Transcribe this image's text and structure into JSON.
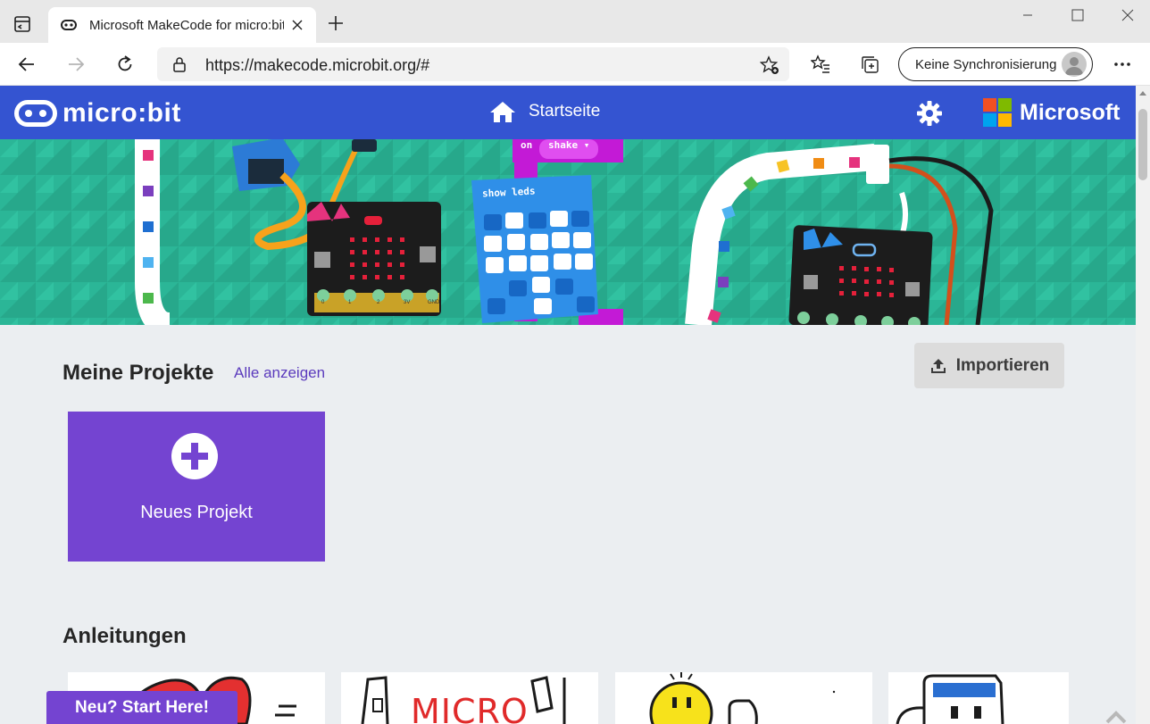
{
  "browser": {
    "tab_title": "Microsoft MakeCode for micro:bit",
    "url": "https://makecode.microbit.org/#",
    "sync_label": "Keine Synchronisierung"
  },
  "header": {
    "logo_text": "micro:bit",
    "home_label": "Startseite",
    "brand_text": "Microsoft",
    "brand_colors": [
      "#f25022",
      "#7fba00",
      "#00a4ef",
      "#ffb900"
    ],
    "accent": "#3454d1"
  },
  "hero": {
    "block_on": "on",
    "block_shake": "shake ▾",
    "block_show_leds": "show leds",
    "pin_labels": [
      "0",
      "1",
      "2",
      "3V",
      "GND"
    ]
  },
  "projects": {
    "title": "Meine Projekte",
    "see_all": "Alle anzeigen",
    "import_label": "Importieren",
    "new_project_label": "Neues Projekt"
  },
  "tutorials": {
    "title": "Anleitungen",
    "card_text": "MICRO",
    "start_here": "Neu? Start Here!"
  }
}
